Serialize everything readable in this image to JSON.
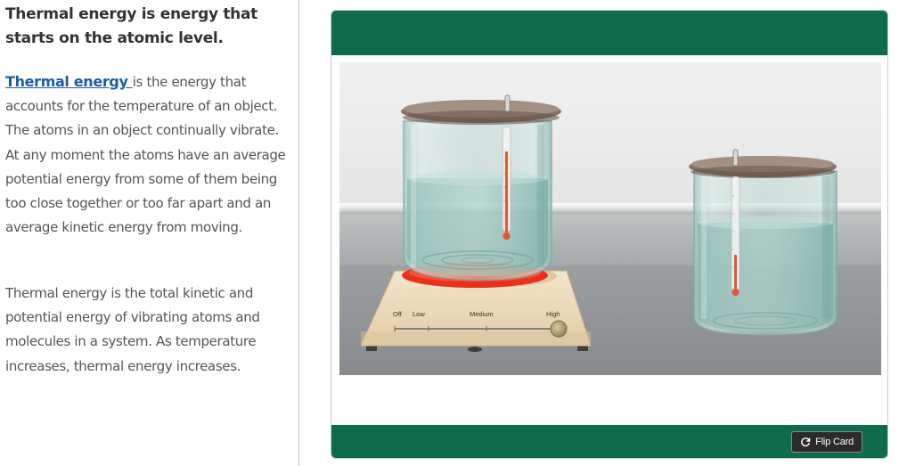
{
  "sidebar": {
    "heading": "Thermal energy is energy that starts on the atomic level.",
    "para1_link": "Thermal energy ",
    "para1_rest": "is the energy that accounts for the temperature of an object. The atoms in an object continually vibrate. At any moment the atoms have an average potential energy from some of them being too close together or too far apart and an average kinetic energy from moving.",
    "para2": "Thermal energy is the total kinetic and potential energy of vibrating atoms and molecules in a system. As temperature increases, thermal energy increases."
  },
  "card": {
    "header_color": "#0e6b4c",
    "flip_label": "Flip Card",
    "flip_icon": "refresh-icon"
  },
  "simulation": {
    "hotplate_labels": {
      "off": "Off",
      "low": "Low",
      "medium": "Medium",
      "high": "High"
    },
    "heat_setting": "High",
    "colors": {
      "heater_ring": "#e8311c",
      "thermometer_fluid": "#e8562f",
      "lid": "#7a6457"
    }
  }
}
